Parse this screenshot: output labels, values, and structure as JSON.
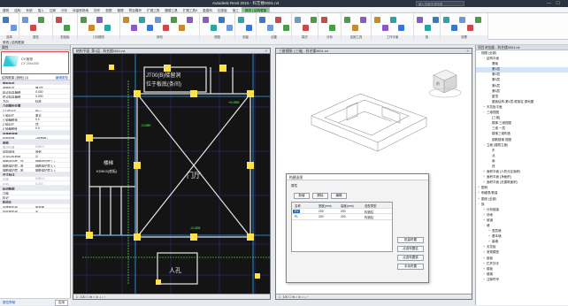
{
  "app": {
    "title": "Autodesk Revit 2016 -    科艺楼0001.rvt",
    "search_placeholder": "键入关键字或短语",
    "window_controls": "— ☐ ✕"
  },
  "tabs": [
    "建筑",
    "结构",
    "系统",
    "插入",
    "注释",
    "分析",
    "体量和场地",
    "协作",
    "视图",
    "管理",
    "附加模块",
    "扩展工具",
    "圆模工具",
    "扩展工具4",
    "盈建科",
    "柱梁板",
    "施工",
    "修改 | 结构框架"
  ],
  "active_tab_index": 17,
  "ribbon_groups": [
    "选择",
    "属性",
    "剪贴板",
    "几何图形",
    "修改",
    "视图",
    "测量",
    "创建",
    "模式",
    "分析",
    "加固工具",
    "工作平面",
    "族",
    "放置"
  ],
  "options_bar": "修改 | 结构框架",
  "properties": {
    "header": "属性",
    "type_name1": "CY-矩形",
    "type_name2": "CY 200x200",
    "selector": "结构框架 (其他) (1)",
    "edit_type": "编辑类型",
    "rows": [
      {
        "k": "限制条件",
        "v": "",
        "sec": true
      },
      {
        "k": "参照标高",
        "v": "第1层"
      },
      {
        "k": "起点标高偏移",
        "v": "0.000"
      },
      {
        "k": "终点标高偏移",
        "v": "0.000"
      },
      {
        "k": "方向",
        "v": "标准"
      },
      {
        "k": "几何图形位置",
        "v": "",
        "sec": true
      },
      {
        "k": "YZ 轴对正",
        "v": "统一"
      },
      {
        "k": "Y 轴对正",
        "v": "原点"
      },
      {
        "k": "Y 轴偏移值",
        "v": "0.0"
      },
      {
        "k": "Z 轴对正",
        "v": "顶"
      },
      {
        "k": "Z 轴偏移值",
        "v": "0.0"
      },
      {
        "k": "材质和装饰",
        "v": "",
        "sec": true
      },
      {
        "k": "结构材质",
        "v": "<按类别>"
      },
      {
        "k": "结构",
        "v": "",
        "sec": true
      },
      {
        "k": "剪切长度",
        "v": "5380.0",
        "dim": true
      },
      {
        "k": "结构用途",
        "v": "其他"
      },
      {
        "k": "启用分析模型",
        "v": "☑"
      },
      {
        "k": "钢筋保护层 - 顶",
        "v": "钢筋保护层 1 <"
      },
      {
        "k": "钢筋保护层 - 底",
        "v": "钢筋保护层 1 <"
      },
      {
        "k": "钢筋保护层 - 其",
        "v": "钢筋保护层 1 <"
      },
      {
        "k": "尺寸标注",
        "v": "",
        "sec": true
      },
      {
        "k": "长度",
        "v": "5380.0",
        "dim": true
      },
      {
        "k": "体积",
        "v": "0.215",
        "dim": true
      },
      {
        "k": "标识数据",
        "v": "",
        "sec": true
      },
      {
        "k": "注释",
        "v": ""
      },
      {
        "k": "标记",
        "v": ""
      },
      {
        "k": "阶段化",
        "v": "",
        "sec": true
      },
      {
        "k": "创建的阶段",
        "v": "新构造"
      },
      {
        "k": "拆除的阶段",
        "v": "无"
      }
    ],
    "help_link": "属性帮助",
    "apply_button": "应用"
  },
  "plan_view": {
    "title": "结构平面: 第1层 - 科艺楼0001.rvt",
    "room_main": "门厅",
    "room_left1": "楼梯",
    "room_left2": "KDB03(底板)",
    "label_top1": "JT00(B)楼留洞",
    "label_top2": "位于板底(条间)",
    "label_dim1": "-0.050",
    "label_dim2": "-0.425",
    "label_bottom": "人孔",
    "label_right": "+0.050",
    "footer": "1 : 100   ☐ ⊕ ◐ ⊘ ◑ ⌂ ‹"
  },
  "view3d": {
    "title": "三维视图: {三维} - 科艺楼0001.rvt",
    "footer": "1 : 100   ☐ ⊕ ◐ ⊘ ◑ ⌂ ‹",
    "cube_label": "前"
  },
  "dialog": {
    "title": "构建选项",
    "caption": "属性",
    "btn_add": "新增",
    "btn_del": "删除",
    "btn_edit": "编辑",
    "columns": [
      "名称",
      "宽度(mm)",
      "高度(mm)",
      "选型类型"
    ],
    "rows": [
      [
        "P1",
        "200",
        "200",
        "构造柱"
      ],
      [
        "PL",
        "200",
        "200",
        "构造柱"
      ]
    ],
    "right_buttons": [
      "批量布置",
      "点选布置柱",
      "点选布置梁",
      "手动布置"
    ]
  },
  "browser": {
    "title": "项目浏览器 - 科艺楼0001.rvt",
    "items": [
      {
        "t": "视图 (全部)",
        "lvl": 0,
        "ex": "−"
      },
      {
        "t": "结构平面",
        "lvl": 1,
        "ex": "−"
      },
      {
        "t": "基础",
        "lvl": 2
      },
      {
        "t": "第1层",
        "lvl": 2,
        "hl": true
      },
      {
        "t": "第2层",
        "lvl": 2
      },
      {
        "t": "第3层",
        "lvl": 2
      },
      {
        "t": "第4层",
        "lvl": 2
      },
      {
        "t": "第5层",
        "lvl": 2
      },
      {
        "t": "屋顶",
        "lvl": 2
      },
      {
        "t": "屋面结构-第1层-框架柱 原地图",
        "lvl": 2
      },
      {
        "t": "天花板平面",
        "lvl": 1,
        "ex": "+"
      },
      {
        "t": "三维视图",
        "lvl": 1,
        "ex": "−"
      },
      {
        "t": "{三维}",
        "lvl": 2
      },
      {
        "t": "楼梯 三维视图",
        "lvl": 2
      },
      {
        "t": "三维 一层",
        "lvl": 2
      },
      {
        "t": "楼梯三维构造",
        "lvl": 2
      },
      {
        "t": "钢筋楼梯 视图",
        "lvl": 2
      },
      {
        "t": "立面 (建筑立面)",
        "lvl": 1,
        "ex": "−"
      },
      {
        "t": "东",
        "lvl": 2
      },
      {
        "t": "北",
        "lvl": 2
      },
      {
        "t": "南",
        "lvl": 2
      },
      {
        "t": "西",
        "lvl": 2
      },
      {
        "t": "面积平面 (人防分区面积)",
        "lvl": 1,
        "ex": "+"
      },
      {
        "t": "面积平面 (净面积)",
        "lvl": 1,
        "ex": "+"
      },
      {
        "t": "面积平面 (总建筑面积)",
        "lvl": 1,
        "ex": "+"
      },
      {
        "t": "图例",
        "lvl": 0,
        "ex": "+"
      },
      {
        "t": "明细表/数量",
        "lvl": 0,
        "ex": "+"
      },
      {
        "t": "图纸 (全部)",
        "lvl": 0,
        "ex": "+"
      },
      {
        "t": "族",
        "lvl": 0,
        "ex": "−"
      },
      {
        "t": "分析链接",
        "lvl": 1,
        "ex": "+"
      },
      {
        "t": "场地",
        "lvl": 1,
        "ex": "+"
      },
      {
        "t": "坡道",
        "lvl": 1,
        "ex": "+"
      },
      {
        "t": "墙",
        "lvl": 1,
        "ex": "−"
      },
      {
        "t": "叠层墙",
        "lvl": 2,
        "ex": "+"
      },
      {
        "t": "基本墙",
        "lvl": 2,
        "ex": "+"
      },
      {
        "t": "幕墙",
        "lvl": 2,
        "ex": "+"
      },
      {
        "t": "天花板",
        "lvl": 1,
        "ex": "+"
      },
      {
        "t": "常规模型",
        "lvl": 1,
        "ex": "+"
      },
      {
        "t": "嵌板",
        "lvl": 1,
        "ex": "+"
      },
      {
        "t": "栏杆扶手",
        "lvl": 1,
        "ex": "+"
      },
      {
        "t": "楼板",
        "lvl": 1,
        "ex": "+"
      },
      {
        "t": "楼梯",
        "lvl": 1,
        "ex": "+"
      },
      {
        "t": "注释符号",
        "lvl": 1,
        "ex": "+"
      }
    ]
  },
  "colors": {
    "ribbon_context": "#7dd07d",
    "plan_bg": "#141414",
    "grip": "#ffe14a",
    "accent": "#2b6bd6"
  }
}
